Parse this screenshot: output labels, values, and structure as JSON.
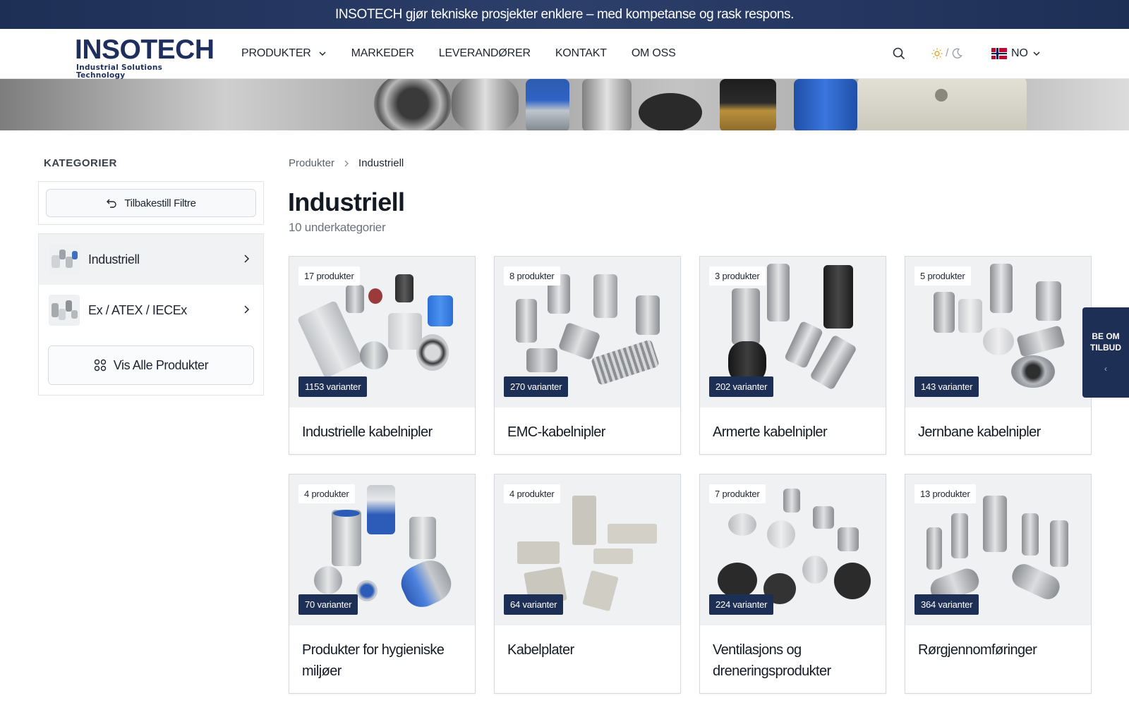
{
  "announcement": "INSOTECH gjør tekniske prosjekter enklere – med kompetanse og rask respons.",
  "logo": {
    "name": "INSOTECH",
    "tagline": "Industrial Solutions Technology"
  },
  "nav": {
    "items": [
      {
        "label": "PRODUKTER"
      },
      {
        "label": "MARKEDER"
      },
      {
        "label": "LEVERANDØRER"
      },
      {
        "label": "KONTAKT"
      },
      {
        "label": "OM OSS"
      }
    ],
    "theme_separator": "/",
    "language": "NO"
  },
  "sidebar": {
    "title": "KATEGORIER",
    "reset_label": "Tilbakestill Filtre",
    "categories": [
      {
        "label": "Industriell",
        "active": true
      },
      {
        "label": "Ex / ATEX / IECEx",
        "active": false
      }
    ],
    "view_all_label": "Vis Alle Produkter"
  },
  "breadcrumb": {
    "parent": "Produkter",
    "current": "Industriell"
  },
  "page": {
    "title": "Industriell",
    "subtitle": "10 underkategorier"
  },
  "products": [
    {
      "count": "17 produkter",
      "variants": "1153 varianter",
      "name": "Industrielle kabelnipler"
    },
    {
      "count": "8 produkter",
      "variants": "270 varianter",
      "name": "EMC-kabelnipler"
    },
    {
      "count": "3 produkter",
      "variants": "202 varianter",
      "name": "Armerte kabelnipler"
    },
    {
      "count": "5 produkter",
      "variants": "143 varianter",
      "name": "Jernbane kabelnipler"
    },
    {
      "count": "4 produkter",
      "variants": "70 varianter",
      "name": "Produkter for hygieniske miljøer"
    },
    {
      "count": "4 produkter",
      "variants": "64 varianter",
      "name": "Kabelplater"
    },
    {
      "count": "7 produkter",
      "variants": "224 varianter",
      "name": "Ventilasjons og dreneringsprodukter"
    },
    {
      "count": "13 produkter",
      "variants": "364 varianter",
      "name": "Rørgjennomføringer"
    }
  ],
  "quote_tab": {
    "line1": "BE OM",
    "line2": "TILBUD",
    "arrow": "‹"
  },
  "colors": {
    "brand_navy": "#1e2f56",
    "accent_blue": "#2d63c7"
  }
}
